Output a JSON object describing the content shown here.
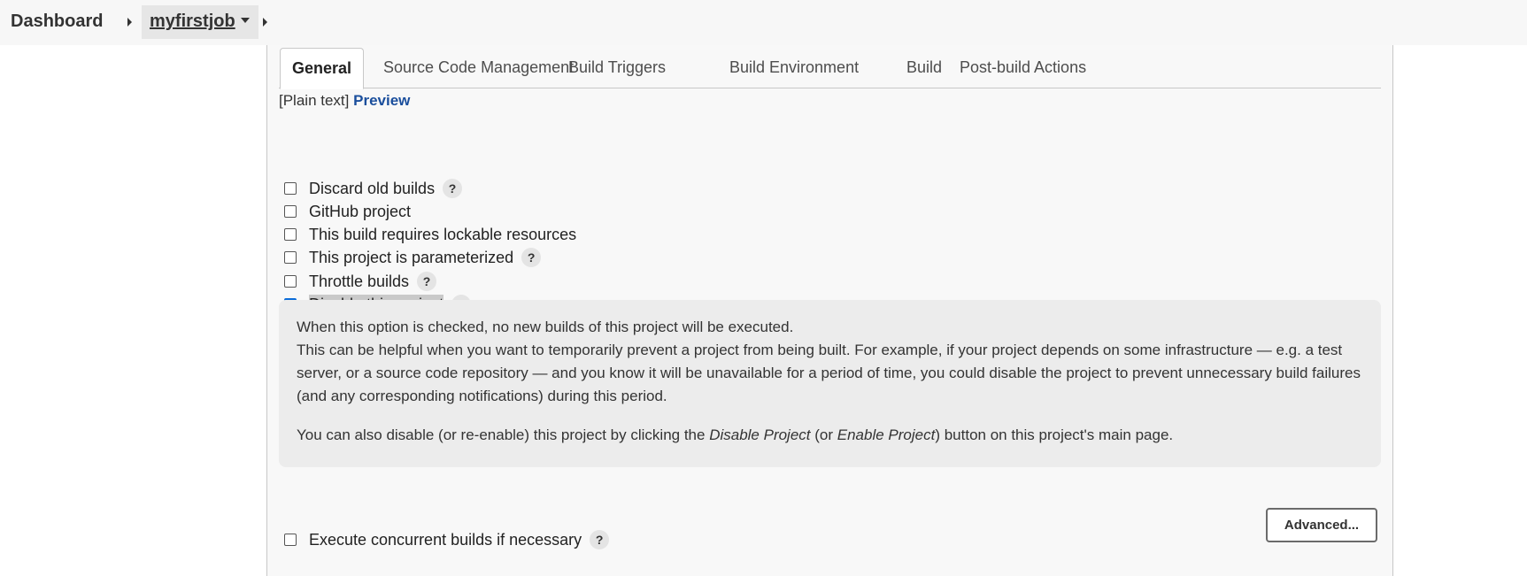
{
  "breadcrumb": {
    "dashboard": "Dashboard",
    "job": "myfirstjob"
  },
  "tabs": [
    {
      "label": "General",
      "active": true
    },
    {
      "label": "Source Code Management"
    },
    {
      "label": "Build Triggers"
    },
    {
      "label": "Build Environment"
    },
    {
      "label": "Build"
    },
    {
      "label": "Post-build Actions"
    }
  ],
  "description": {
    "plain_text": "[Plain text]",
    "preview": "Preview"
  },
  "options": [
    {
      "label": "Discard old builds",
      "checked": false,
      "help": "?"
    },
    {
      "label": "GitHub project",
      "checked": false
    },
    {
      "label": "This build requires lockable resources",
      "checked": false
    },
    {
      "label": "This project is parameterized",
      "checked": false,
      "help": "?"
    },
    {
      "label": "Throttle builds",
      "checked": false,
      "help": "?"
    },
    {
      "label": "Disable this project",
      "checked": true,
      "help": "?"
    }
  ],
  "help_text": {
    "line1": "When this option is checked, no new builds of this project will be executed.",
    "line2": "This can be helpful when you want to temporarily prevent a project from being built. For example, if your project depends on some infrastructure — e.g. a test server, or a source code repository — and you know it will be unavailable for a period of time, you could disable the project to prevent unnecessary build failures (and any corresponding notifications) during this period.",
    "line3_pre": "You can also disable (or re-enable) this project by clicking the ",
    "line3_em1": "Disable Project",
    "line3_mid": " (or ",
    "line3_em2": "Enable Project",
    "line3_post": ") button on this project's main page."
  },
  "concurrent": {
    "label": "Execute concurrent builds if necessary",
    "checked": false,
    "help": "?"
  },
  "advanced_button": "Advanced..."
}
